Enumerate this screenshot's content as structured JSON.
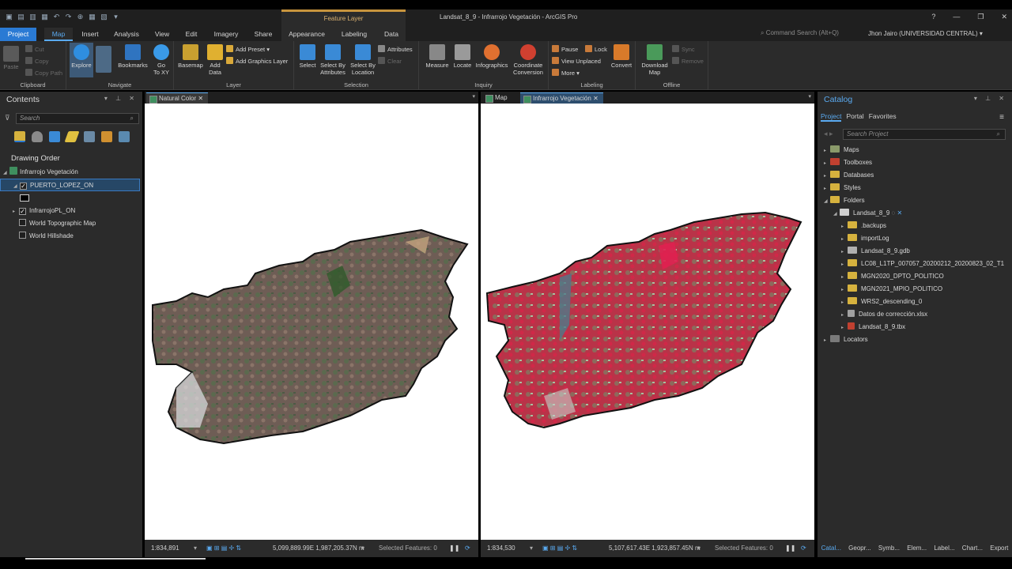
{
  "window": {
    "title": "Landsat_8_9 - Infrarrojo Vegetación - ArcGIS Pro",
    "context_tab": "Feature Layer",
    "help": "?",
    "minimize": "—",
    "restore": "❐",
    "close": "✕"
  },
  "tabs": [
    "Project",
    "Map",
    "Insert",
    "Analysis",
    "View",
    "Edit",
    "Imagery",
    "Share",
    "Appearance",
    "Labeling",
    "Data"
  ],
  "command_search": "Command Search (Alt+Q)",
  "user": "Jhon Jairo (UNIVERSIDAD CENTRAL) ▾",
  "ribbon": {
    "clipboard": {
      "label": "Clipboard",
      "paste": "Paste",
      "cut": "Cut",
      "copy": "Copy",
      "copy_path": "Copy Path"
    },
    "navigate": {
      "label": "Navigate",
      "explore": "Explore",
      "bookmarks": "Bookmarks",
      "goto": "Go\nTo XY"
    },
    "layer": {
      "label": "Layer",
      "basemap": "Basemap",
      "add_data": "Add\nData",
      "add_preset": "Add Preset ▾",
      "add_graphics": "Add Graphics Layer"
    },
    "selection": {
      "label": "Selection",
      "select": "Select",
      "by_attr": "Select By\nAttributes",
      "by_loc": "Select By\nLocation",
      "attributes": "Attributes",
      "clear": "Clear"
    },
    "inquiry": {
      "label": "Inquiry",
      "measure": "Measure",
      "locate": "Locate",
      "infographics": "Infographics",
      "coord": "Coordinate\nConversion"
    },
    "labeling": {
      "label": "Labeling",
      "pause": "Pause",
      "lock": "Lock",
      "view_unplaced": "View Unplaced",
      "more": "More ▾",
      "convert": "Convert"
    },
    "offline": {
      "label": "Offline",
      "download": "Download\nMap",
      "sync": "Sync",
      "remove": "Remove"
    }
  },
  "contents": {
    "title": "Contents",
    "search_placeholder": "Search",
    "drawing_order": "Drawing Order",
    "layers": [
      {
        "name": "Infrarrojo Vegetación",
        "checked": false
      },
      {
        "name": "PUERTO_LOPEZ_ON",
        "checked": true
      },
      {
        "name": "InfrarrojoPL_ON",
        "checked": true
      },
      {
        "name": "World Topographic Map",
        "checked": false
      },
      {
        "name": "World Hillshade",
        "checked": false
      }
    ]
  },
  "map1": {
    "tab": "Natural Color",
    "scale": "1:834,891",
    "coords": "5,099,889.99E 1,987,205.37N m",
    "selected": "Selected Features: 0"
  },
  "map2": {
    "tab_a": "Map",
    "tab_b": "Infrarrojo Vegetación",
    "scale": "1:834,530",
    "coords": "5,107,617.43E 1,923,857.45N m",
    "selected": "Selected Features: 0"
  },
  "catalog": {
    "title": "Catalog",
    "tabs": [
      "Project",
      "Portal",
      "Favorites"
    ],
    "search_placeholder": "Search Project",
    "items": [
      {
        "name": "Maps"
      },
      {
        "name": "Toolboxes"
      },
      {
        "name": "Databases"
      },
      {
        "name": "Styles"
      },
      {
        "name": "Folders"
      },
      {
        "name": "Landsat_8_9"
      },
      {
        "name": ".backups"
      },
      {
        "name": "importLog"
      },
      {
        "name": "Landsat_8_9.gdb"
      },
      {
        "name": "LC08_L1TP_007057_20200212_20200823_02_T1"
      },
      {
        "name": "MGN2020_DPTO_POLITICO"
      },
      {
        "name": "MGN2021_MPIO_POLITICO"
      },
      {
        "name": "WRS2_descending_0"
      },
      {
        "name": "Datos de corrección.xlsx"
      },
      {
        "name": "Landsat_8_9.tbx"
      },
      {
        "name": "Locators"
      }
    ],
    "bottom_tabs": [
      "Catal...",
      "Geopr...",
      "Symb...",
      "Elem...",
      "Label...",
      "Chart...",
      "Export"
    ]
  }
}
